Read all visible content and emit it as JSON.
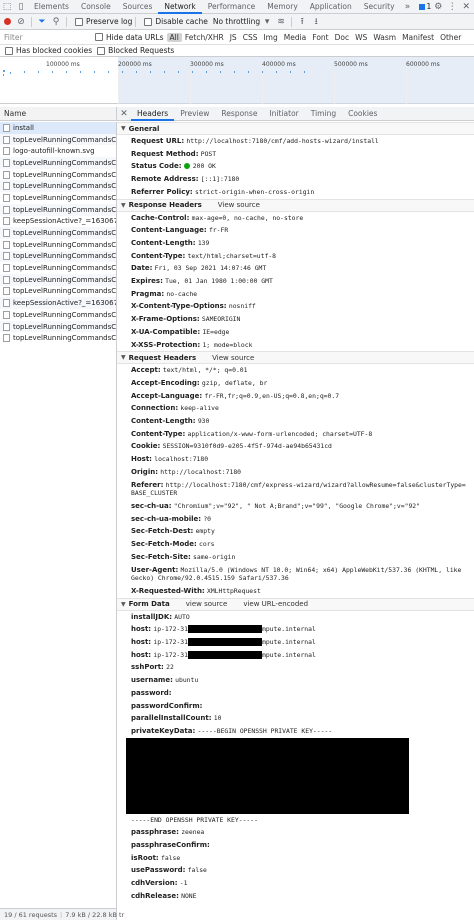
{
  "devtools_tabs": [
    "Elements",
    "Console",
    "Sources",
    "Network",
    "Performance",
    "Memory",
    "Application",
    "Security"
  ],
  "badge_count": "1",
  "toolbar": {
    "preserve_log": "Preserve log",
    "disable_cache": "Disable cache",
    "throttling": "No throttling"
  },
  "filter": {
    "placeholder": "Filter",
    "hide_data_urls": "Hide data URLs",
    "types": [
      "All",
      "Fetch/XHR",
      "JS",
      "CSS",
      "Img",
      "Media",
      "Font",
      "Doc",
      "WS",
      "Wasm",
      "Manifest",
      "Other"
    ]
  },
  "blocked": {
    "has_blocked_cookies": "Has blocked cookies",
    "blocked_requests": "Blocked Requests"
  },
  "overview_ticks": [
    "100000 ms",
    "200000 ms",
    "300000 ms",
    "400000 ms",
    "500000 ms",
    "600000 ms"
  ],
  "list": {
    "header": "Name",
    "requests": [
      "install",
      "topLevelRunningCommandsC...",
      "logo-autofill-known.svg",
      "topLevelRunningCommandsC...",
      "topLevelRunningCommandsC...",
      "topLevelRunningCommandsC...",
      "topLevelRunningCommandsC...",
      "topLevelRunningCommandsC...",
      "keepSessionActive?_=163067...",
      "topLevelRunningCommandsC...",
      "topLevelRunningCommandsC...",
      "topLevelRunningCommandsC...",
      "topLevelRunningCommandsC...",
      "topLevelRunningCommandsC...",
      "topLevelRunningCommandsC...",
      "keepSessionActive?_=163067...",
      "topLevelRunningCommandsC...",
      "topLevelRunningCommandsC...",
      "topLevelRunningCommandsC..."
    ],
    "status": "19 / 61 requests",
    "size": "7.9 kB / 22.8 kB tr"
  },
  "detail_tabs": [
    "Headers",
    "Preview",
    "Response",
    "Initiator",
    "Timing",
    "Cookies"
  ],
  "general": {
    "title": "General",
    "rows": [
      {
        "k": "Request URL:",
        "v": "http://localhost:7180/cmf/add-hosts-wizard/install"
      },
      {
        "k": "Request Method:",
        "v": "POST"
      },
      {
        "k": "Status Code:",
        "v": "200 OK"
      },
      {
        "k": "Remote Address:",
        "v": "[::1]:7180"
      },
      {
        "k": "Referrer Policy:",
        "v": "strict-origin-when-cross-origin"
      }
    ]
  },
  "response_headers": {
    "title": "Response Headers",
    "view_source": "View source",
    "rows": [
      {
        "k": "Cache-Control:",
        "v": "max-age=0, no-cache, no-store"
      },
      {
        "k": "Content-Language:",
        "v": "fr-FR"
      },
      {
        "k": "Content-Length:",
        "v": "139"
      },
      {
        "k": "Content-Type:",
        "v": "text/html;charset=utf-8"
      },
      {
        "k": "Date:",
        "v": "Fri, 03 Sep 2021 14:07:46 GMT"
      },
      {
        "k": "Expires:",
        "v": "Tue, 01 Jan 1980 1:00:00 GMT"
      },
      {
        "k": "Pragma:",
        "v": "no-cache"
      },
      {
        "k": "X-Content-Type-Options:",
        "v": "nosniff"
      },
      {
        "k": "X-Frame-Options:",
        "v": "SAMEORIGIN"
      },
      {
        "k": "X-UA-Compatible:",
        "v": "IE=edge"
      },
      {
        "k": "X-XSS-Protection:",
        "v": "1; mode=block"
      }
    ]
  },
  "request_headers": {
    "title": "Request Headers",
    "view_source": "View source",
    "rows": [
      {
        "k": "Accept:",
        "v": "text/html, */*; q=0.01"
      },
      {
        "k": "Accept-Encoding:",
        "v": "gzip, deflate, br"
      },
      {
        "k": "Accept-Language:",
        "v": "fr-FR,fr;q=0.9,en-US;q=0.8,en;q=0.7"
      },
      {
        "k": "Connection:",
        "v": "keep-alive"
      },
      {
        "k": "Content-Length:",
        "v": "930"
      },
      {
        "k": "Content-Type:",
        "v": "application/x-www-form-urlencoded; charset=UTF-8"
      },
      {
        "k": "Cookie:",
        "v": "SESSION=9310f0d9-e205-4f5f-974d-ae94b65431cd"
      },
      {
        "k": "Host:",
        "v": "localhost:7180"
      },
      {
        "k": "Origin:",
        "v": "http://localhost:7180"
      },
      {
        "k": "Referer:",
        "v": "http://localhost:7180/cmf/express-wizard/wizard?allowResume=false&clusterType=BASE_CLUSTER"
      },
      {
        "k": "sec-ch-ua:",
        "v": "\"Chromium\";v=\"92\", \" Not A;Brand\";v=\"99\", \"Google Chrome\";v=\"92\""
      },
      {
        "k": "sec-ch-ua-mobile:",
        "v": "?0"
      },
      {
        "k": "Sec-Fetch-Dest:",
        "v": "empty"
      },
      {
        "k": "Sec-Fetch-Mode:",
        "v": "cors"
      },
      {
        "k": "Sec-Fetch-Site:",
        "v": "same-origin"
      },
      {
        "k": "User-Agent:",
        "v": "Mozilla/5.0 (Windows NT 10.0; Win64; x64) AppleWebKit/537.36 (KHTML, like Gecko) Chrome/92.0.4515.159 Safari/537.36"
      },
      {
        "k": "X-Requested-With:",
        "v": "XMLHttpRequest"
      }
    ]
  },
  "form_data": {
    "title": "Form Data",
    "view_source": "view source",
    "view_url_encoded": "view URL-encoded",
    "installJDK": {
      "k": "installJDK:",
      "v": "AUTO"
    },
    "hosts": [
      {
        "k": "host:",
        "prefix": "ip-172-31",
        "suffix": "mpute.internal"
      },
      {
        "k": "host:",
        "prefix": "ip-172-31",
        "suffix": "mpute.internal"
      },
      {
        "k": "host:",
        "prefix": "ip-172-31",
        "suffix": "mpute.internal"
      }
    ],
    "rows_a": [
      {
        "k": "sshPort:",
        "v": "22"
      },
      {
        "k": "username:",
        "v": "ubuntu"
      },
      {
        "k": "password:",
        "v": ""
      },
      {
        "k": "passwordConfirm:",
        "v": ""
      },
      {
        "k": "parallelInstallCount:",
        "v": "10"
      }
    ],
    "private_key": {
      "k": "privateKeyData:",
      "begin": "-----BEGIN OPENSSH PRIVATE KEY-----",
      "end": "-----END OPENSSH PRIVATE KEY-----"
    },
    "rows_b": [
      {
        "k": "passphrase:",
        "v": "zeenea"
      },
      {
        "k": "passphraseConfirm:",
        "v": ""
      },
      {
        "k": "isRoot:",
        "v": "false"
      },
      {
        "k": "usePassword:",
        "v": "false"
      },
      {
        "k": "cdhVersion:",
        "v": "-1"
      },
      {
        "k": "cdhRelease:",
        "v": "NONE"
      }
    ]
  }
}
